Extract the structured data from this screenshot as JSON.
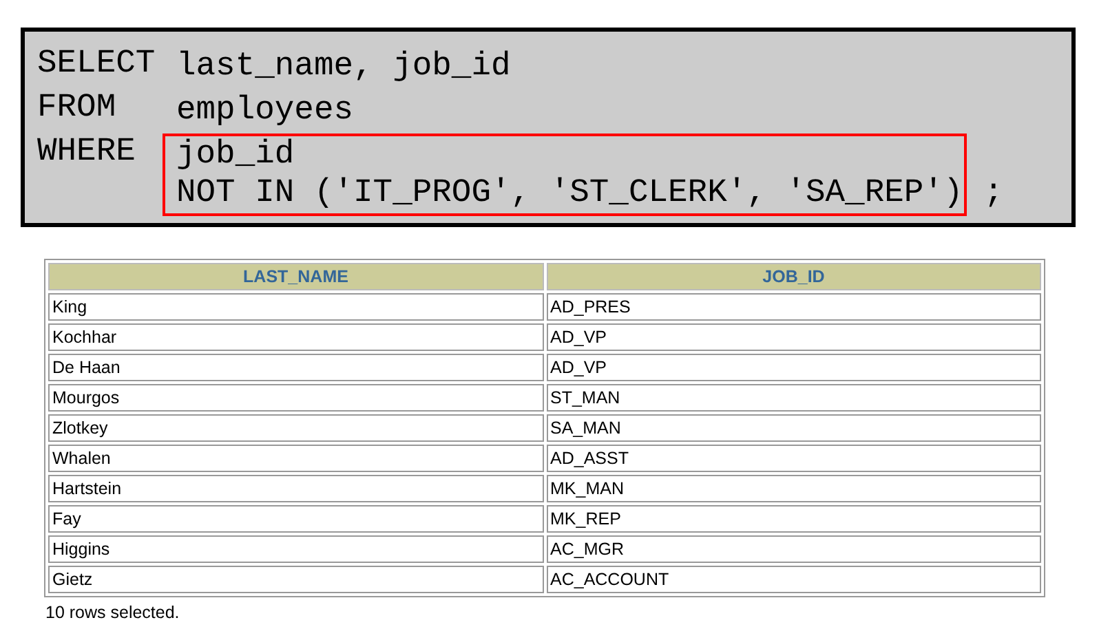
{
  "query": {
    "clauses": [
      {
        "keyword": "SELECT",
        "lines": [
          "last_name, job_id"
        ],
        "highlighted": false
      },
      {
        "keyword": "FROM",
        "lines": [
          "employees"
        ],
        "highlighted": false
      },
      {
        "keyword": "WHERE",
        "lines": [
          "job_id",
          "NOT IN ('IT_PROG', 'ST_CLERK', 'SA_REP')"
        ],
        "highlighted": true,
        "terminator": ";"
      }
    ]
  },
  "table": {
    "columns": [
      "LAST_NAME",
      "JOB_ID"
    ],
    "rows": [
      [
        "King",
        "AD_PRES"
      ],
      [
        "Kochhar",
        "AD_VP"
      ],
      [
        "De Haan",
        "AD_VP"
      ],
      [
        "Mourgos",
        "ST_MAN"
      ],
      [
        "Zlotkey",
        "SA_MAN"
      ],
      [
        "Whalen",
        "AD_ASST"
      ],
      [
        "Hartstein",
        "MK_MAN"
      ],
      [
        "Fay",
        "MK_REP"
      ],
      [
        "Higgins",
        "AC_MGR"
      ],
      [
        "Gietz",
        "AC_ACCOUNT"
      ]
    ]
  },
  "status": "10 rows selected."
}
